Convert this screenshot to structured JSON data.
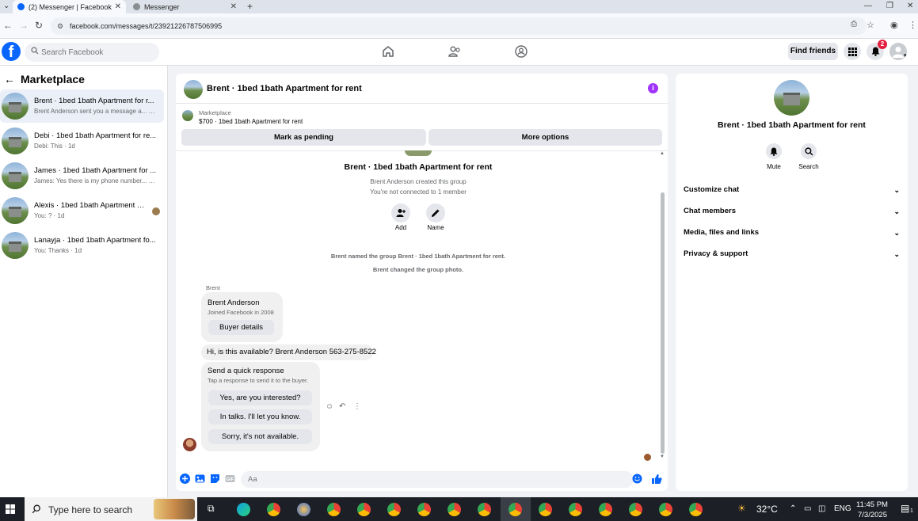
{
  "browser": {
    "tabs": [
      {
        "title": "(2) Messenger | Facebook",
        "active": true
      },
      {
        "title": "Messenger",
        "active": false
      }
    ],
    "new_tab": "+",
    "url": "facebook.com/messages/t/23921226787506995"
  },
  "header": {
    "logo": "f",
    "search_placeholder": "Search Facebook",
    "find_friends": "Find friends",
    "notification_count": "2"
  },
  "left_panel": {
    "title": "Marketplace",
    "conversations": [
      {
        "title": "Brent · 1bed 1bath Apartment for r...",
        "snippet": "Brent Anderson sent you a message a... · 1h",
        "active": true
      },
      {
        "title": "Debi · 1bed 1bath Apartment for re...",
        "snippet": "Debi: This · 1d",
        "active": false
      },
      {
        "title": "James · 1bed 1bath Apartment for ...",
        "snippet": "James: Yes there is my phone number... · 1d",
        "active": false
      },
      {
        "title": "Alexis · 1bed 1bath Apartment f...",
        "snippet": "You: ? · 1d",
        "active": false
      },
      {
        "title": "Lanayja · 1bed 1bath Apartment fo...",
        "snippet": "You: Thanks · 1d",
        "active": false
      }
    ]
  },
  "chat": {
    "title": "Brent · 1bed 1bath Apartment for rent",
    "marketplace_label": "Marketplace",
    "listing": "$700 · 1bed 1bath Apartment for rent",
    "mark_pending": "Mark as pending",
    "more_options": "More options",
    "group_title": "Brent · 1bed 1bath Apartment for rent",
    "created_by": "Brent Anderson created this group",
    "not_connected": "You're not connected to 1 member",
    "add_label": "Add",
    "name_label": "Name",
    "system_1": "Brent named the group Brent · 1bed 1bath Apartment for rent.",
    "system_2": "Brent changed the group photo.",
    "sender": "Brent",
    "card_name": "Brent Anderson",
    "card_sub": "Joined Facebook in 2008",
    "buyer_details": "Buyer details",
    "message": "Hi, is this available? Brent Anderson 563-275-8522",
    "quick_title": "Send a quick response",
    "quick_sub": "Tap a response to send it to the buyer.",
    "quick_1": "Yes, are you interested?",
    "quick_2": "In talks. I'll let you know.",
    "quick_3": "Sorry, it's not available.",
    "input_placeholder": "Aa"
  },
  "right_panel": {
    "title": "Brent · 1bed 1bath Apartment for rent",
    "mute": "Mute",
    "search": "Search",
    "sections": [
      "Customize chat",
      "Chat members",
      "Media, files and links",
      "Privacy & support"
    ]
  },
  "taskbar": {
    "search_placeholder": "Type here to search",
    "weather": "32°C",
    "language": "ENG",
    "time": "11:45 PM",
    "date": "7/3/2025",
    "notifications": "1"
  },
  "colors": {
    "fb_blue": "#0866ff",
    "badge_red": "#e41e3f",
    "info_purple": "#a033ff"
  }
}
